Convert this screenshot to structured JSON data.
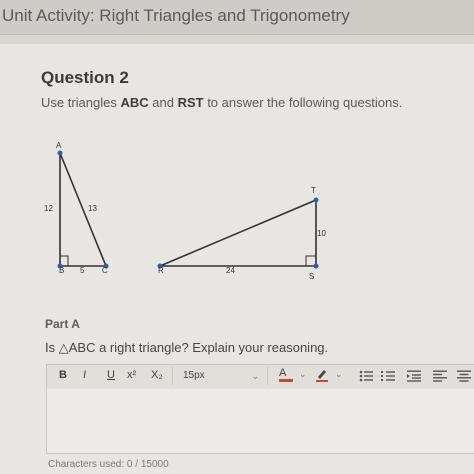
{
  "header": {
    "title": "Unit Activity: Right Triangles and Trigonometry"
  },
  "question": {
    "title": "Question 2",
    "prompt_before": "Use triangles ",
    "prompt_abc": "ABC",
    "prompt_mid": " and ",
    "prompt_rst": "RST",
    "prompt_after": " to answer the following questions."
  },
  "triangle_abc": {
    "vertex_a": "A",
    "vertex_b": "B",
    "vertex_c": "C",
    "side_ab": "12",
    "side_ac": "13",
    "side_bc": "5"
  },
  "triangle_rst": {
    "vertex_r": "R",
    "vertex_s": "S",
    "vertex_t": "T",
    "side_rs": "24",
    "side_st": "10"
  },
  "part_a": {
    "label": "Part A",
    "question": "Is △ABC a right triangle? Explain your reasoning."
  },
  "toolbar": {
    "bold": "B",
    "italic": "I",
    "underline": "U",
    "superscript": "x²",
    "subscript": "X₂",
    "font_size": "15px",
    "font_color": "A",
    "icons": [
      "bulleted-list-icon",
      "numbered-list-icon",
      "indent-icon",
      "align-left-icon",
      "align-center-icon"
    ]
  },
  "editor": {
    "value": ""
  },
  "footer": {
    "characters_used": "Characters used: 0 / 15000"
  },
  "colors": {
    "vertex_dot": "#2f5f9e",
    "figure_line": "#333333",
    "accent_underline": "#c4492e"
  }
}
